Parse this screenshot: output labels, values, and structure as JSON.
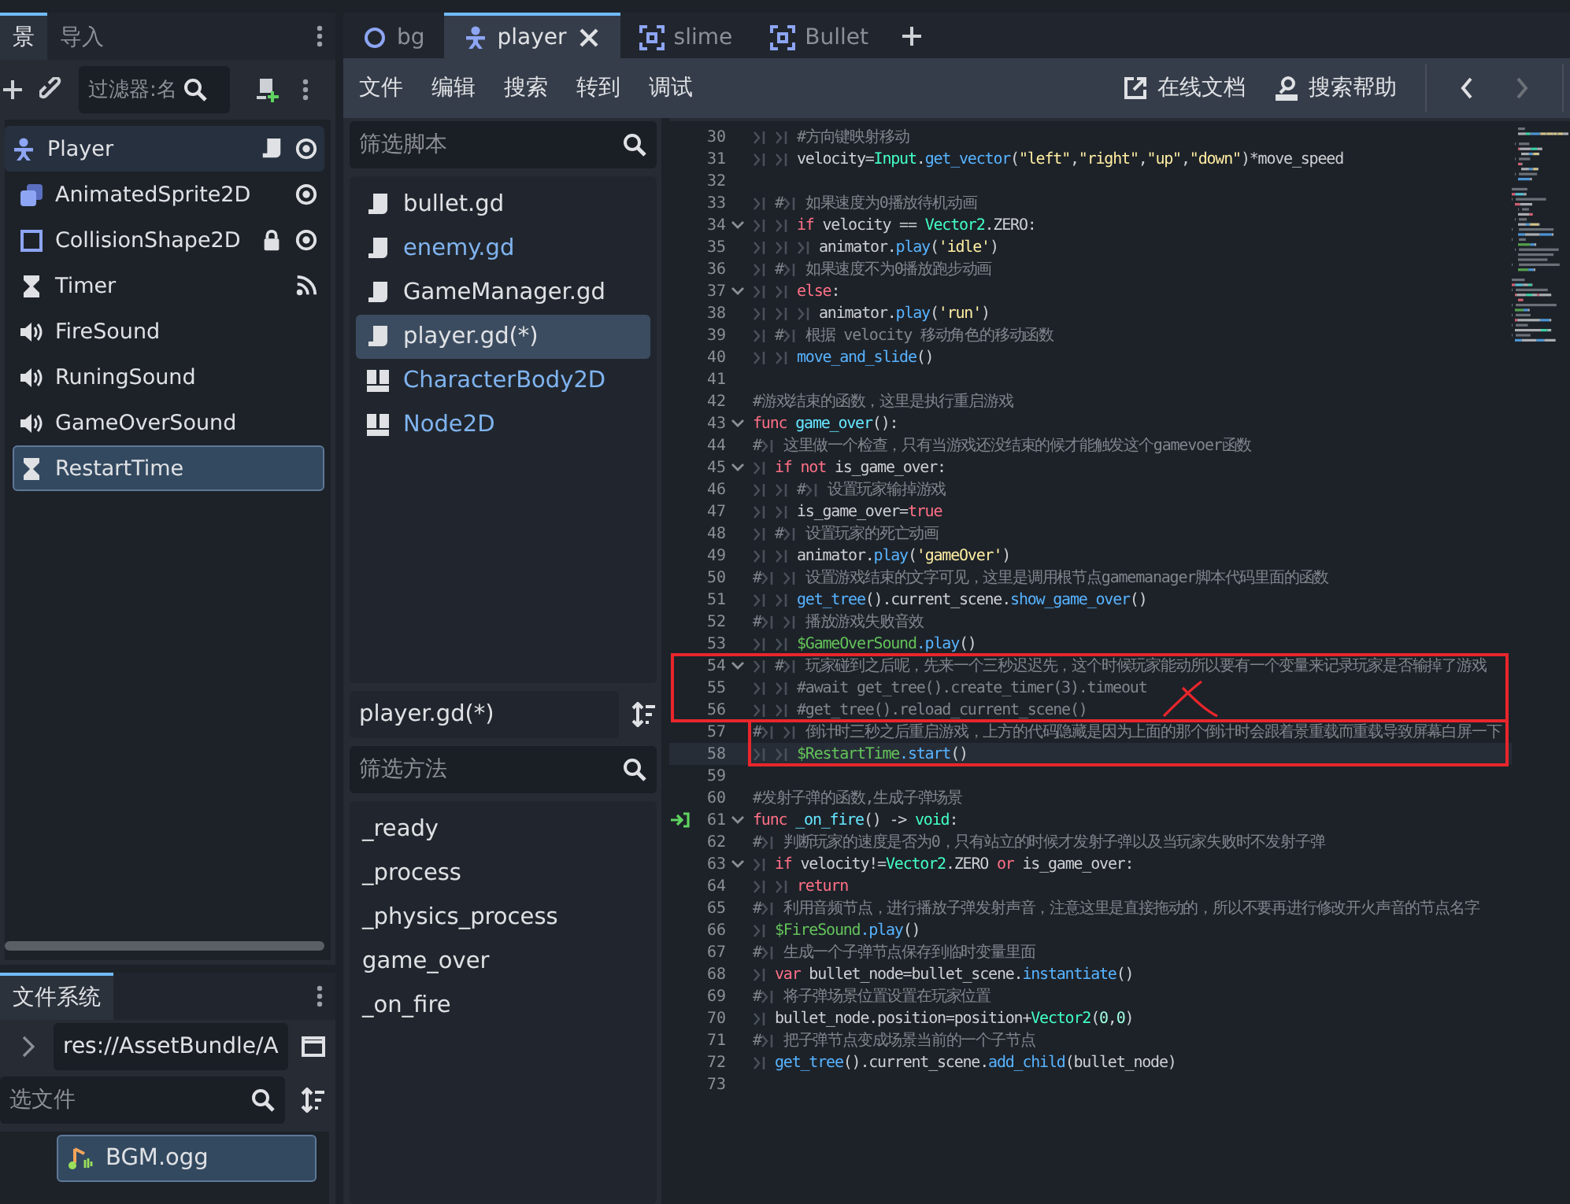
{
  "scene_dock": {
    "tabs": [
      {
        "label": "景",
        "selected": true
      },
      {
        "label": "导入",
        "selected": false
      }
    ],
    "filter": {
      "placeholder": "过滤器:名"
    },
    "tree": {
      "name": "Player",
      "kind": "character",
      "badges": [
        {
          "kind": "script"
        },
        {
          "kind": "eye"
        }
      ],
      "selected": false,
      "highlighted": true,
      "children": [
        {
          "name": "AnimatedSprite2D",
          "kind": "sprite",
          "badges": [
            {
              "kind": "eye"
            }
          ],
          "selected": false,
          "highlighted": false
        },
        {
          "name": "CollisionShape2D",
          "kind": "collision",
          "badges": [
            {
              "kind": "lock"
            },
            {
              "kind": "eye"
            }
          ],
          "selected": false,
          "highlighted": false
        },
        {
          "name": "Timer",
          "kind": "timer",
          "badges": [
            {
              "kind": "signal"
            }
          ],
          "selected": false,
          "highlighted": false
        },
        {
          "name": "FireSound",
          "kind": "sound",
          "selected": false,
          "highlighted": false
        },
        {
          "name": "RuningSound",
          "kind": "sound",
          "selected": false,
          "highlighted": false
        },
        {
          "name": "GameOverSound",
          "kind": "sound",
          "selected": false,
          "highlighted": false
        },
        {
          "name": "RestartTime",
          "kind": "timer",
          "selected": true,
          "highlighted": false
        }
      ]
    }
  },
  "filesystem_dock": {
    "tabs": [
      {
        "label": "文件系统",
        "selected": true
      }
    ],
    "path": "res://AssetBundle/A",
    "filter": {
      "placeholder": "选文件"
    },
    "files": [
      {
        "name": "BGM.ogg",
        "kind": "audio",
        "selected": true
      }
    ]
  },
  "editor_tabs": [
    {
      "label": "bg",
      "kind": "circle",
      "selected": false
    },
    {
      "label": "player",
      "kind": "character",
      "selected": true
    },
    {
      "label": "slime",
      "kind": "frame",
      "selected": false
    },
    {
      "label": "Bullet",
      "kind": "frame",
      "selected": false
    }
  ],
  "script_menu": [
    "文件",
    "编辑",
    "搜索",
    "转到",
    "调试"
  ],
  "help_links": [
    {
      "label": "在线文档",
      "kind": "external"
    },
    {
      "label": "搜索帮助",
      "kind": "doc-search"
    }
  ],
  "script_panel": {
    "filter": {
      "placeholder": "筛选脚本"
    },
    "scripts": [
      {
        "name": "bullet.gd",
        "kind": "script",
        "color": "#dfe1e4",
        "selected": false
      },
      {
        "name": "enemy.gd",
        "kind": "script",
        "color": "#7fb3ef",
        "selected": false
      },
      {
        "name": "GameManager.gd",
        "kind": "script",
        "color": "#dfe1e4",
        "selected": false
      },
      {
        "name": "player.gd(*)",
        "kind": "script",
        "color": "#dfe1e4",
        "selected": true
      },
      {
        "name": "CharacterBody2D",
        "kind": "doc",
        "color": "#7fb3ef",
        "selected": false
      },
      {
        "name": "Node2D",
        "kind": "doc",
        "color": "#7fb3ef",
        "selected": false
      }
    ],
    "current": "player.gd(*)",
    "method_filter": {
      "placeholder": "筛选方法"
    },
    "methods": [
      "_ready",
      "_process",
      "_physics_process",
      "game_over",
      "_on_fire"
    ]
  },
  "code": {
    "sections": [
      {
        "boxed": false,
        "crossed": false,
        "lines": [
          {
            "number": "30",
            "fold": false,
            "signal": false,
            "current": false,
            "segments": [
              {
                "kind": "tab"
              },
              {
                "kind": "tab"
              },
              {
                "kind": "cmt",
                "text": "#方向键映射移动"
              }
            ]
          },
          {
            "number": "31",
            "fold": false,
            "signal": false,
            "current": false,
            "segments": [
              {
                "kind": "tab"
              },
              {
                "kind": "tab"
              },
              {
                "kind": "plain",
                "text": "velocity="
              },
              {
                "kind": "cls",
                "text": "Input"
              },
              {
                "kind": "plain",
                "text": "."
              },
              {
                "kind": "fn",
                "text": "get_vector"
              },
              {
                "kind": "plain",
                "text": "("
              },
              {
                "kind": "str",
                "text": "\"left\""
              },
              {
                "kind": "plain",
                "text": ","
              },
              {
                "kind": "str",
                "text": "\"right\""
              },
              {
                "kind": "plain",
                "text": ","
              },
              {
                "kind": "str",
                "text": "\"up\""
              },
              {
                "kind": "plain",
                "text": ","
              },
              {
                "kind": "str",
                "text": "\"down\""
              },
              {
                "kind": "plain",
                "text": ")*move_speed"
              }
            ]
          },
          {
            "number": "32",
            "fold": false,
            "signal": false,
            "current": false
          },
          {
            "number": "33",
            "fold": false,
            "signal": false,
            "current": false,
            "segments": [
              {
                "kind": "tab"
              },
              {
                "kind": "cmt",
                "text": "#"
              },
              {
                "kind": "tab"
              },
              {
                "kind": "cmt",
                "text": "如果速度为0播放待机动画"
              }
            ]
          },
          {
            "number": "34",
            "fold": true,
            "signal": false,
            "current": false,
            "segments": [
              {
                "kind": "tab"
              },
              {
                "kind": "tab"
              },
              {
                "kind": "kw",
                "text": "if"
              },
              {
                "kind": "plain",
                "text": " velocity == "
              },
              {
                "kind": "cls",
                "text": "Vector2"
              },
              {
                "kind": "plain",
                "text": ".ZERO:"
              }
            ]
          },
          {
            "number": "35",
            "fold": false,
            "signal": false,
            "current": false,
            "segments": [
              {
                "kind": "tab"
              },
              {
                "kind": "tab"
              },
              {
                "kind": "tab"
              },
              {
                "kind": "plain",
                "text": "animator."
              },
              {
                "kind": "fn",
                "text": "play"
              },
              {
                "kind": "plain",
                "text": "("
              },
              {
                "kind": "str",
                "text": "'idle'"
              },
              {
                "kind": "plain",
                "text": ")"
              }
            ]
          },
          {
            "number": "36",
            "fold": false,
            "signal": false,
            "current": false,
            "segments": [
              {
                "kind": "tab"
              },
              {
                "kind": "cmt",
                "text": "#"
              },
              {
                "kind": "tab"
              },
              {
                "kind": "cmt",
                "text": "如果速度不为0播放跑步动画"
              }
            ]
          },
          {
            "number": "37",
            "fold": true,
            "signal": false,
            "current": false,
            "segments": [
              {
                "kind": "tab"
              },
              {
                "kind": "tab"
              },
              {
                "kind": "kw",
                "text": "else"
              },
              {
                "kind": "plain",
                "text": ":"
              }
            ]
          },
          {
            "number": "38",
            "fold": false,
            "signal": false,
            "current": false,
            "segments": [
              {
                "kind": "tab"
              },
              {
                "kind": "tab"
              },
              {
                "kind": "tab"
              },
              {
                "kind": "plain",
                "text": "animator."
              },
              {
                "kind": "fn",
                "text": "play"
              },
              {
                "kind": "plain",
                "text": "("
              },
              {
                "kind": "str",
                "text": "'run'"
              },
              {
                "kind": "plain",
                "text": ")"
              }
            ]
          },
          {
            "number": "39",
            "fold": false,
            "signal": false,
            "current": false,
            "segments": [
              {
                "kind": "tab"
              },
              {
                "kind": "cmt",
                "text": "#"
              },
              {
                "kind": "tab"
              },
              {
                "kind": "cmt",
                "text": "根据 velocity 移动角色的移动函数"
              }
            ]
          },
          {
            "number": "40",
            "fold": false,
            "signal": false,
            "current": false,
            "segments": [
              {
                "kind": "tab"
              },
              {
                "kind": "tab"
              },
              {
                "kind": "fn",
                "text": "move_and_slide"
              },
              {
                "kind": "plain",
                "text": "()"
              }
            ]
          },
          {
            "number": "41",
            "fold": false,
            "signal": false,
            "current": false
          },
          {
            "number": "42",
            "fold": false,
            "signal": false,
            "current": false,
            "segments": [
              {
                "kind": "cmt",
                "text": "#游戏结束的函数，这里是执行重启游戏"
              }
            ]
          },
          {
            "number": "43",
            "fold": true,
            "signal": false,
            "current": false,
            "segments": [
              {
                "kind": "kw",
                "text": "func"
              },
              {
                "kind": "fdef",
                "text": " game_over"
              },
              {
                "kind": "plain",
                "text": "():"
              }
            ]
          },
          {
            "number": "44",
            "fold": false,
            "signal": false,
            "current": false,
            "segments": [
              {
                "kind": "cmt",
                "text": "#"
              },
              {
                "kind": "tab"
              },
              {
                "kind": "cmt",
                "text": "这里做一个检查，只有当游戏还没结束的候才能触发这个gamevoer函数"
              }
            ]
          },
          {
            "number": "45",
            "fold": true,
            "signal": false,
            "current": false,
            "segments": [
              {
                "kind": "tab"
              },
              {
                "kind": "kw",
                "text": "if"
              },
              {
                "kind": "kw",
                "text": " not"
              },
              {
                "kind": "plain",
                "text": " is_game_over:"
              }
            ]
          },
          {
            "number": "46",
            "fold": false,
            "signal": false,
            "current": false,
            "segments": [
              {
                "kind": "tab"
              },
              {
                "kind": "tab"
              },
              {
                "kind": "cmt",
                "text": "#"
              },
              {
                "kind": "tab"
              },
              {
                "kind": "cmt",
                "text": "设置玩家输掉游戏"
              }
            ]
          },
          {
            "number": "47",
            "fold": false,
            "signal": false,
            "current": false,
            "segments": [
              {
                "kind": "tab"
              },
              {
                "kind": "tab"
              },
              {
                "kind": "plain",
                "text": "is_game_over="
              },
              {
                "kind": "kw",
                "text": "true"
              }
            ]
          },
          {
            "number": "48",
            "fold": false,
            "signal": false,
            "current": false,
            "segments": [
              {
                "kind": "tab"
              },
              {
                "kind": "cmt",
                "text": "#"
              },
              {
                "kind": "tab"
              },
              {
                "kind": "cmt",
                "text": "设置玩家的死亡动画"
              }
            ]
          },
          {
            "number": "49",
            "fold": false,
            "signal": false,
            "current": false,
            "segments": [
              {
                "kind": "tab"
              },
              {
                "kind": "tab"
              },
              {
                "kind": "plain",
                "text": "animator."
              },
              {
                "kind": "fn",
                "text": "play"
              },
              {
                "kind": "plain",
                "text": "("
              },
              {
                "kind": "str",
                "text": "'gameOver'"
              },
              {
                "kind": "plain",
                "text": ")"
              }
            ]
          },
          {
            "number": "50",
            "fold": false,
            "signal": false,
            "current": false,
            "segments": [
              {
                "kind": "cmt",
                "text": "#"
              },
              {
                "kind": "tab"
              },
              {
                "kind": "tab"
              },
              {
                "kind": "cmt",
                "text": "设置游戏结束的文字可见，这里是调用根节点gamemanager脚本代码里面的函数"
              }
            ]
          },
          {
            "number": "51",
            "fold": false,
            "signal": false,
            "current": false,
            "segments": [
              {
                "kind": "tab"
              },
              {
                "kind": "tab"
              },
              {
                "kind": "fn",
                "text": "get_tree"
              },
              {
                "kind": "plain",
                "text": "().current_scene."
              },
              {
                "kind": "fn",
                "text": "show_game_over"
              },
              {
                "kind": "plain",
                "text": "()"
              }
            ]
          },
          {
            "number": "52",
            "fold": false,
            "signal": false,
            "current": false,
            "segments": [
              {
                "kind": "cmt",
                "text": "#"
              },
              {
                "kind": "tab"
              },
              {
                "kind": "tab"
              },
              {
                "kind": "cmt",
                "text": "播放游戏失败音效"
              }
            ]
          },
          {
            "number": "53",
            "fold": false,
            "signal": false,
            "current": false,
            "segments": [
              {
                "kind": "tab"
              },
              {
                "kind": "tab"
              },
              {
                "kind": "node",
                "text": "$GameOverSound"
              },
              {
                "kind": "fn",
                "text": ".play"
              },
              {
                "kind": "plain",
                "text": "()"
              }
            ]
          }
        ]
      },
      {
        "boxed": true,
        "crossed": true,
        "lines": [
          {
            "number": "54",
            "fold": true,
            "signal": false,
            "current": false,
            "segments": [
              {
                "kind": "tab"
              },
              {
                "kind": "cmt",
                "text": "#"
              },
              {
                "kind": "tab"
              },
              {
                "kind": "cmt",
                "text": "玩家碰到之后呢，先来一个三秒迟迟先，这个时候玩家能动所以要有一个变量来记录玩家是否输掉了游戏"
              }
            ]
          },
          {
            "number": "55",
            "fold": false,
            "signal": false,
            "current": false,
            "segments": [
              {
                "kind": "tab"
              },
              {
                "kind": "tab"
              },
              {
                "kind": "cmt",
                "text": "#await get_tree().create_timer(3).timeout"
              }
            ]
          },
          {
            "number": "56",
            "fold": false,
            "signal": false,
            "current": false,
            "segments": [
              {
                "kind": "tab"
              },
              {
                "kind": "tab"
              },
              {
                "kind": "cmt",
                "text": "#get_tree().reload_current_scene()"
              }
            ]
          }
        ]
      },
      {
        "boxed": true,
        "crossed": false,
        "lines": [
          {
            "number": "57",
            "fold": false,
            "signal": false,
            "current": false,
            "segments": [
              {
                "kind": "cmt",
                "text": "#"
              },
              {
                "kind": "tab"
              },
              {
                "kind": "tab"
              },
              {
                "kind": "cmt",
                "text": "倒计时三秒之后重启游戏，上方的代码隐藏是因为上面的那个倒计时会跟着景重载而重载导致屏幕白屏一下"
              }
            ]
          },
          {
            "number": "58",
            "fold": false,
            "signal": false,
            "current": true,
            "segments": [
              {
                "kind": "tab"
              },
              {
                "kind": "tab"
              },
              {
                "kind": "node",
                "text": "$RestartTime"
              },
              {
                "kind": "fn",
                "text": ".start"
              },
              {
                "kind": "plain",
                "text": "()"
              }
            ]
          }
        ]
      },
      {
        "boxed": false,
        "crossed": false,
        "lines": [
          {
            "number": "59",
            "fold": false,
            "signal": false,
            "current": false
          },
          {
            "number": "60",
            "fold": false,
            "signal": false,
            "current": false,
            "segments": [
              {
                "kind": "cmt",
                "text": "#发射子弹的函数,生成子弹场景"
              }
            ]
          },
          {
            "number": "61",
            "fold": true,
            "signal": true,
            "current": false,
            "segments": [
              {
                "kind": "kw",
                "text": "func"
              },
              {
                "kind": "fdef",
                "text": " _on_fire"
              },
              {
                "kind": "plain",
                "text": "() -> "
              },
              {
                "kind": "cls",
                "text": "void"
              },
              {
                "kind": "plain",
                "text": ":"
              }
            ]
          },
          {
            "number": "62",
            "fold": false,
            "signal": false,
            "current": false,
            "segments": [
              {
                "kind": "cmt",
                "text": "#"
              },
              {
                "kind": "tab"
              },
              {
                "kind": "cmt",
                "text": "判断玩家的速度是否为0，只有站立的时候才发射子弹以及当玩家失败时不发射子弹"
              }
            ]
          },
          {
            "number": "63",
            "fold": true,
            "signal": false,
            "current": false,
            "segments": [
              {
                "kind": "tab"
              },
              {
                "kind": "kw",
                "text": "if"
              },
              {
                "kind": "plain",
                "text": " velocity!="
              },
              {
                "kind": "cls",
                "text": "Vector2"
              },
              {
                "kind": "plain",
                "text": ".ZERO "
              },
              {
                "kind": "kw",
                "text": "or"
              },
              {
                "kind": "plain",
                "text": " is_game_over:"
              }
            ]
          },
          {
            "number": "64",
            "fold": false,
            "signal": false,
            "current": false,
            "segments": [
              {
                "kind": "tab"
              },
              {
                "kind": "tab"
              },
              {
                "kind": "kw",
                "text": "return"
              }
            ]
          },
          {
            "number": "65",
            "fold": false,
            "signal": false,
            "current": false,
            "segments": [
              {
                "kind": "cmt",
                "text": "#"
              },
              {
                "kind": "tab"
              },
              {
                "kind": "cmt",
                "text": "利用音频节点，进行播放子弹发射声音，注意这里是直接拖动的，所以不要再进行修改开火声音的节点名字"
              }
            ]
          },
          {
            "number": "66",
            "fold": false,
            "signal": false,
            "current": false,
            "segments": [
              {
                "kind": "tab"
              },
              {
                "kind": "node",
                "text": "$FireSound"
              },
              {
                "kind": "fn",
                "text": ".play"
              },
              {
                "kind": "plain",
                "text": "()"
              }
            ]
          },
          {
            "number": "67",
            "fold": false,
            "signal": false,
            "current": false,
            "segments": [
              {
                "kind": "cmt",
                "text": "#"
              },
              {
                "kind": "tab"
              },
              {
                "kind": "cmt",
                "text": "生成一个子弹节点保存到临时变量里面"
              }
            ]
          },
          {
            "number": "68",
            "fold": false,
            "signal": false,
            "current": false,
            "segments": [
              {
                "kind": "tab"
              },
              {
                "kind": "kw",
                "text": "var"
              },
              {
                "kind": "plain",
                "text": " bullet_node=bullet_scene."
              },
              {
                "kind": "fn",
                "text": "instantiate"
              },
              {
                "kind": "plain",
                "text": "()"
              }
            ]
          },
          {
            "number": "69",
            "fold": false,
            "signal": false,
            "current": false,
            "segments": [
              {
                "kind": "cmt",
                "text": "#"
              },
              {
                "kind": "tab"
              },
              {
                "kind": "cmt",
                "text": "将子弹场景位置设置在玩家位置"
              }
            ]
          },
          {
            "number": "70",
            "fold": false,
            "signal": false,
            "current": false,
            "segments": [
              {
                "kind": "tab"
              },
              {
                "kind": "plain",
                "text": "bullet_node.position=position+"
              },
              {
                "kind": "cls",
                "text": "Vector2"
              },
              {
                "kind": "plain",
                "text": "("
              },
              {
                "kind": "num",
                "text": "0"
              },
              {
                "kind": "plain",
                "text": ","
              },
              {
                "kind": "num",
                "text": "0"
              },
              {
                "kind": "plain",
                "text": ")"
              }
            ]
          },
          {
            "number": "71",
            "fold": false,
            "signal": false,
            "current": false,
            "segments": [
              {
                "kind": "cmt",
                "text": "#"
              },
              {
                "kind": "tab"
              },
              {
                "kind": "cmt",
                "text": "把子弹节点变成场景当前的一个子节点"
              }
            ]
          },
          {
            "number": "72",
            "fold": false,
            "signal": false,
            "current": false,
            "segments": [
              {
                "kind": "tab"
              },
              {
                "kind": "fn",
                "text": "get_tree"
              },
              {
                "kind": "plain",
                "text": "().current_scene."
              },
              {
                "kind": "fn",
                "text": "add_child"
              },
              {
                "kind": "plain",
                "text": "(bullet_node)"
              }
            ]
          },
          {
            "number": "73",
            "fold": false,
            "signal": false,
            "current": false
          }
        ]
      }
    ]
  }
}
